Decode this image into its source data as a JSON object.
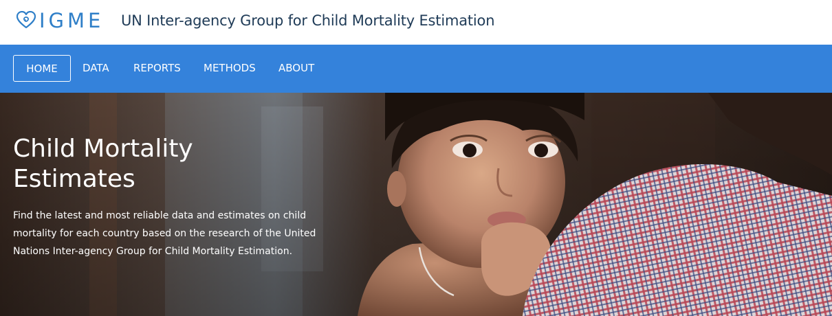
{
  "brand": {
    "logo_text": "IGME",
    "site_title": "UN Inter-agency Group for Child Mortality Estimation"
  },
  "nav": {
    "items": [
      {
        "label": "HOME",
        "active": true
      },
      {
        "label": "DATA",
        "active": false
      },
      {
        "label": "REPORTS",
        "active": false
      },
      {
        "label": "METHODS",
        "active": false
      },
      {
        "label": "ABOUT",
        "active": false
      }
    ]
  },
  "hero": {
    "title": "Child Mortality Estimates",
    "description": "Find the latest and most reliable data and estimates on child mortality for each country based on the research of the United Nations Inter-agency Group for Child Mortality Estimation."
  },
  "colors": {
    "brand_blue": "#2f7fc8",
    "nav_blue": "#3482db",
    "title_navy": "#1f3b57"
  },
  "icons": {
    "logo": "heart-swirl-icon"
  }
}
